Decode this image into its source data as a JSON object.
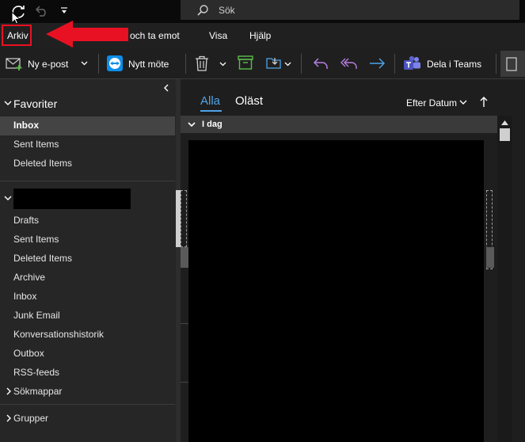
{
  "titlebar": {
    "search_placeholder": "Sök"
  },
  "menu": {
    "file": "Arkiv",
    "send_receive": "och ta emot",
    "view": "Visa",
    "help": "Hjälp"
  },
  "toolbar": {
    "new_email": "Ny e-post",
    "new_meeting": "Nytt möte",
    "share_teams": "Dela i Teams"
  },
  "nav": {
    "favorites_header": "Favoriter",
    "favorites": [
      "Inbox",
      "Sent Items",
      "Deleted Items"
    ],
    "folders": [
      "Drafts",
      "Sent Items",
      "Deleted Items",
      "Archive",
      "Inbox",
      "Junk Email",
      "Konversationshistorik",
      "Outbox",
      "RSS-feeds"
    ],
    "search_folders": "Sökmappar",
    "groups": "Grupper"
  },
  "list": {
    "tab_all": "Alla",
    "tab_unread": "Oläst",
    "sort": "Efter Datum",
    "group_today": "I dag"
  },
  "colors": {
    "accent": "#4fa3e8",
    "highlight_red": "#e81123"
  }
}
